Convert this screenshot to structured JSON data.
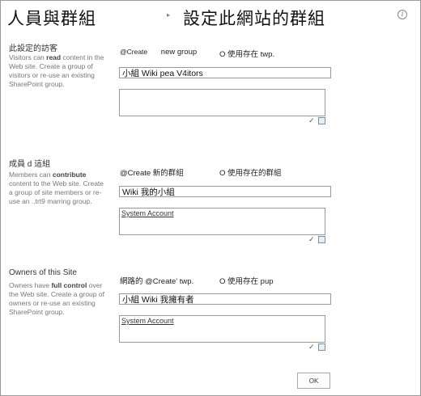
{
  "header": {
    "left_title": "人員與群組",
    "arrow": "▸",
    "right_title": "設定此網站的群組",
    "info_icon": "info-icon"
  },
  "visitors": {
    "title": "此設定的訪客",
    "desc_prefix": "Visitors can ",
    "desc_bold": "read",
    "desc_suffix": " content in the Web site. Create a group of visitors or re-use an existing SharePoint group.",
    "opt_create": "@Create",
    "opt_create_tail": "new group",
    "opt_reuse": "O 使用存在 twp.",
    "name_value": "小組 Wiki pea V4itors",
    "members": ""
  },
  "members": {
    "title": "成員 d 這組",
    "desc_prefix": "Members can ",
    "desc_bold": "contribute",
    "desc_suffix": " content to the Web site. Create a group of site members or re-use an ..trt9 marring              group.",
    "opt_create": "@Create 新的群組",
    "opt_reuse": "O 使用存在的群組",
    "name_value": "Wiki 我的小組",
    "members": "System Account"
  },
  "owners": {
    "title": "Owners of this Site",
    "desc_prefix": "Owners have ",
    "desc_bold": "full control",
    "desc_suffix": " over the Web site. Create a group of owners or re-use an existing SharePoint group.",
    "opt_create": "網路的 @Create' twp.",
    "opt_reuse": "O 使用存在  pup",
    "name_value": "小組 Wiki 我擁有者",
    "members": "System Account"
  },
  "tools": {
    "check_names": "check-names-icon",
    "browse": "address-book-icon",
    "check_glyph": "✓"
  },
  "ok_label": "OK"
}
